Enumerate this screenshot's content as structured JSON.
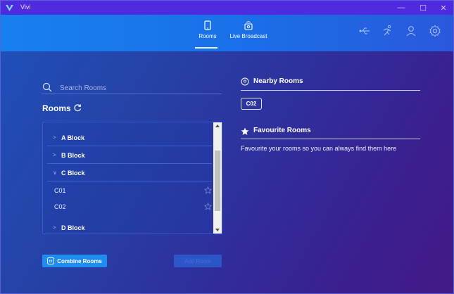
{
  "window": {
    "title": "Vivi",
    "controls": {
      "minimize": "—",
      "maximize": "☐",
      "close": "✕"
    }
  },
  "header": {
    "tabs": [
      {
        "label": "Rooms",
        "icon": "tablet-icon",
        "active": true
      },
      {
        "label": "Live Broadcast",
        "icon": "broadcast-icon",
        "active": false
      }
    ],
    "actions": [
      "usb-icon",
      "runner-icon",
      "user-icon",
      "gear-icon"
    ]
  },
  "search": {
    "placeholder": "Search Rooms"
  },
  "rooms": {
    "title": "Rooms",
    "blocks": [
      {
        "label": "A Block",
        "expanded": false
      },
      {
        "label": "B Block",
        "expanded": false
      },
      {
        "label": "C Block",
        "expanded": true,
        "rooms": [
          "C01",
          "C02"
        ]
      },
      {
        "label": "D Block",
        "expanded": false
      }
    ]
  },
  "buttons": {
    "combine": "Combine Rooms",
    "add_room": "Add Room"
  },
  "nearby": {
    "title": "Nearby Rooms",
    "rooms": [
      "C02"
    ]
  },
  "favourites": {
    "title": "Favourite Rooms",
    "message": "Favourite your rooms so you can always find them here"
  },
  "colors": {
    "accent": "#1f8cf0",
    "titlebar": "#4f2be0",
    "header_start": "#1780f0",
    "background_end": "#431a86"
  }
}
